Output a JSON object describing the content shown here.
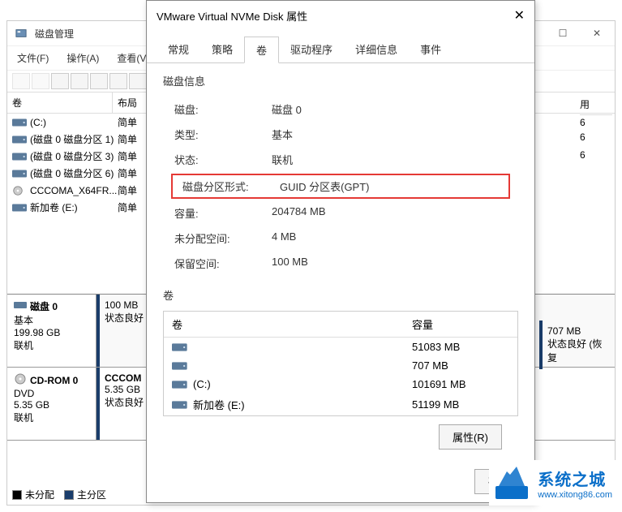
{
  "dm": {
    "title": "磁盘管理",
    "menu": {
      "file": "文件(F)",
      "action": "操作(A)",
      "view": "查看(V)"
    },
    "columns": {
      "volume": "卷",
      "layout": "布局"
    },
    "volumes": [
      {
        "name": "(C:)",
        "layout": "简单",
        "icon": "drive"
      },
      {
        "name": "(磁盘 0 磁盘分区 1)",
        "layout": "简单",
        "icon": "drive"
      },
      {
        "name": "(磁盘 0 磁盘分区 3)",
        "layout": "简单",
        "icon": "drive"
      },
      {
        "name": "(磁盘 0 磁盘分区 6)",
        "layout": "简单",
        "icon": "drive"
      },
      {
        "name": "CCCOMA_X64FR...",
        "layout": "简单",
        "icon": "cd"
      },
      {
        "name": "新加卷 (E:)",
        "layout": "简单",
        "icon": "drive"
      }
    ],
    "disk0": {
      "label": "磁盘 0",
      "type": "基本",
      "size": "199.98 GB",
      "status": "联机",
      "part1_size": "100 MB",
      "part1_status": "状态良好"
    },
    "cdrom": {
      "label": "CD-ROM 0",
      "type": "DVD",
      "size": "5.35 GB",
      "status": "联机",
      "part_name": "CCCOM",
      "part_size": "5.35 GB",
      "part_status": "状态良好"
    },
    "legend": {
      "unalloc": "未分配",
      "primary": "主分区"
    },
    "right_header": "用",
    "right_rows": [
      "6",
      "6",
      "",
      "6"
    ],
    "right_part": {
      "size": "707 MB",
      "status": "状态良好 (恢复"
    }
  },
  "props": {
    "title": "VMware Virtual NVMe Disk 属性",
    "tabs": [
      "常规",
      "策略",
      "卷",
      "驱动程序",
      "详细信息",
      "事件"
    ],
    "active_tab": 2,
    "section_info": "磁盘信息",
    "rows": {
      "disk_label": "磁盘:",
      "disk_value": "磁盘 0",
      "type_label": "类型:",
      "type_value": "基本",
      "status_label": "状态:",
      "status_value": "联机",
      "partstyle_label": "磁盘分区形式:",
      "partstyle_value": "GUID 分区表(GPT)",
      "capacity_label": "容量:",
      "capacity_value": "204784 MB",
      "unalloc_label": "未分配空间:",
      "unalloc_value": "4 MB",
      "reserved_label": "保留空间:",
      "reserved_value": "100 MB"
    },
    "section_vol": "卷",
    "vol_header": {
      "name": "卷",
      "cap": "容量"
    },
    "vol_items": [
      {
        "name": "",
        "cap": "51083 MB"
      },
      {
        "name": "",
        "cap": "707 MB"
      },
      {
        "name": "(C:)",
        "cap": "101691 MB"
      },
      {
        "name": "新加卷 (E:)",
        "cap": "51199 MB"
      }
    ],
    "btn_properties": "属性(R)",
    "btn_ok": "确定"
  },
  "watermark": {
    "cn": "系统之城",
    "url": "www.xitong86.com"
  }
}
